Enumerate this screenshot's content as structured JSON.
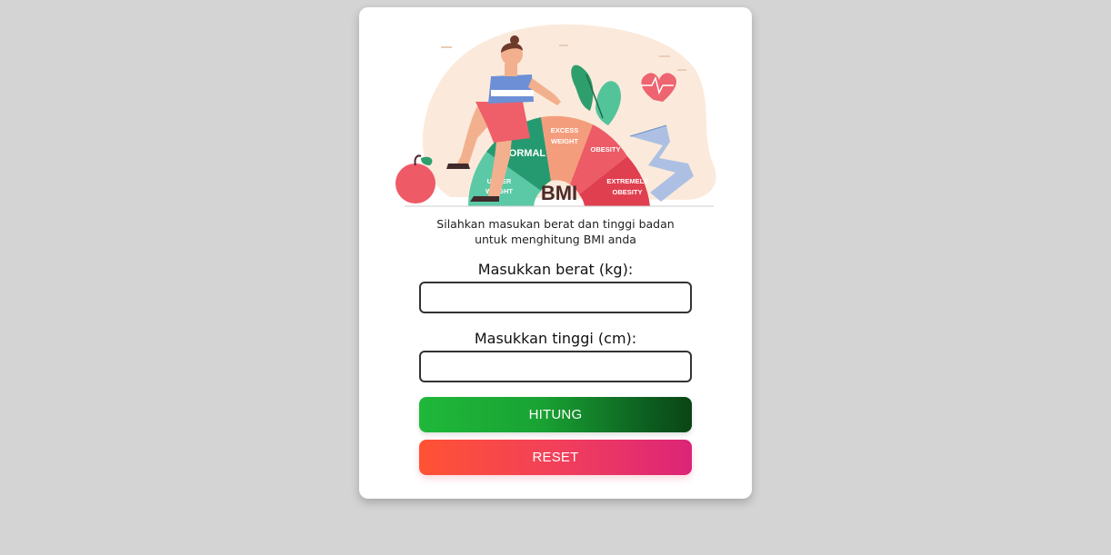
{
  "illustration": {
    "segments": [
      "UNDER WEIGHT",
      "NORMAL",
      "EXCESS WEIGHT",
      "OBESITY",
      "EXTREMELY OBESITY"
    ],
    "center_label": "BMI"
  },
  "intro": {
    "line1": "Silahkan masukan berat dan tinggi badan",
    "line2": "untuk menghitung BMI anda"
  },
  "weight": {
    "label": "Masukkan berat (kg):",
    "value": ""
  },
  "height": {
    "label": "Masukkan tinggi (cm):",
    "value": ""
  },
  "buttons": {
    "calculate": "HITUNG",
    "reset": "RESET"
  },
  "colors": {
    "background": "#d4d4d4",
    "card": "#ffffff",
    "calculate_gradient": [
      "#1fb83a",
      "#0a4515"
    ],
    "reset_gradient": [
      "#ff5233",
      "#dc2478"
    ]
  }
}
